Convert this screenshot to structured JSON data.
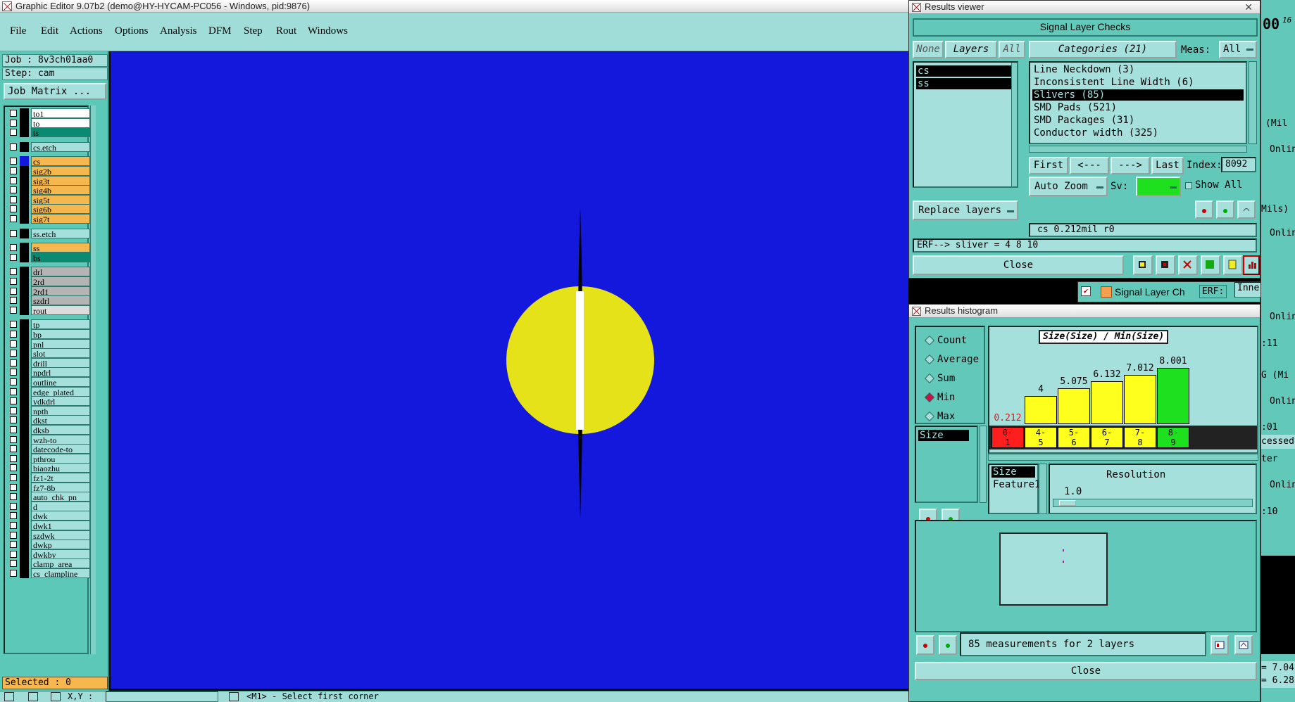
{
  "main_window": {
    "title": "Graphic Editor 9.07b2 (demo@HY-HYCAM-PC056 - Windows, pid:9876)",
    "menu": [
      "File",
      "Edit",
      "Actions",
      "Options",
      "Analysis",
      "DFM",
      "Step",
      "Rout",
      "Windows"
    ],
    "job_line": "Job : 8v3ch01aa0",
    "step_line": "Step: cam",
    "job_matrix_label": "Job Matrix ...",
    "selected_label": "Selected : 0",
    "bottom_coord_label": "X,Y :",
    "bottom_prompt": "<M1> - Select first corner",
    "layers": [
      {
        "name": "to1",
        "color": "#ffffff",
        "group": 0
      },
      {
        "name": "to",
        "color": "#ffffff",
        "group": 0
      },
      {
        "name": "ts",
        "color": "#0a8a70",
        "group": 0
      },
      {
        "name": "cs.etch",
        "color": "#a6e0dc",
        "group": 1
      },
      {
        "name": "cs",
        "color": "#f6b84e",
        "group": 2,
        "active": true
      },
      {
        "name": "sig2b",
        "color": "#f6b84e",
        "group": 2
      },
      {
        "name": "sig3t",
        "color": "#f6b84e",
        "group": 2
      },
      {
        "name": "sig4b",
        "color": "#f6b84e",
        "group": 2
      },
      {
        "name": "sig5t",
        "color": "#f6b84e",
        "group": 2
      },
      {
        "name": "sig6b",
        "color": "#f6b84e",
        "group": 2
      },
      {
        "name": "sig7t",
        "color": "#f6b84e",
        "group": 2
      },
      {
        "name": "ss.etch",
        "color": "#a6e0dc",
        "group": 3
      },
      {
        "name": "ss",
        "color": "#f6b84e",
        "group": 4
      },
      {
        "name": "bs",
        "color": "#0a8a70",
        "group": 4
      },
      {
        "name": "drl",
        "color": "#b4b4b4",
        "group": 5
      },
      {
        "name": "2rd",
        "color": "#b4b4b4",
        "group": 5
      },
      {
        "name": "2rd1",
        "color": "#b4b4b4",
        "group": 5
      },
      {
        "name": "szdrl",
        "color": "#b4b4b4",
        "group": 5
      },
      {
        "name": "rout",
        "color": "#dcdcdc",
        "group": 5
      },
      {
        "name": "tp",
        "color": "#a6e0dc",
        "group": 6
      },
      {
        "name": "bp",
        "color": "#a6e0dc",
        "group": 6
      },
      {
        "name": "pnl",
        "color": "#a6e0dc",
        "group": 6
      },
      {
        "name": "slot",
        "color": "#a6e0dc",
        "group": 6
      },
      {
        "name": "drill",
        "color": "#a6e0dc",
        "group": 6
      },
      {
        "name": "npdrl",
        "color": "#a6e0dc",
        "group": 6
      },
      {
        "name": "outline",
        "color": "#a6e0dc",
        "group": 6
      },
      {
        "name": "edge_plated",
        "color": "#a6e0dc",
        "group": 6
      },
      {
        "name": "ydkdrl",
        "color": "#a6e0dc",
        "group": 6
      },
      {
        "name": "npth",
        "color": "#a6e0dc",
        "group": 6
      },
      {
        "name": "dkst",
        "color": "#a6e0dc",
        "group": 6
      },
      {
        "name": "dksb",
        "color": "#a6e0dc",
        "group": 6
      },
      {
        "name": "wzh-to",
        "color": "#a6e0dc",
        "group": 6
      },
      {
        "name": "datecode-to",
        "color": "#a6e0dc",
        "group": 6
      },
      {
        "name": "pthrou",
        "color": "#a6e0dc",
        "group": 6
      },
      {
        "name": "biaozhu",
        "color": "#a6e0dc",
        "group": 6
      },
      {
        "name": "fz1-2t",
        "color": "#a6e0dc",
        "group": 6
      },
      {
        "name": "fz7-8b",
        "color": "#a6e0dc",
        "group": 6
      },
      {
        "name": "auto_chk_pn",
        "color": "#a6e0dc",
        "group": 6
      },
      {
        "name": "d",
        "color": "#a6e0dc",
        "group": 6
      },
      {
        "name": "dwk",
        "color": "#a6e0dc",
        "group": 6
      },
      {
        "name": "dwk1",
        "color": "#a6e0dc",
        "group": 6
      },
      {
        "name": "szdwk",
        "color": "#a6e0dc",
        "group": 6
      },
      {
        "name": "dwkp",
        "color": "#a6e0dc",
        "group": 6
      },
      {
        "name": "dwkby",
        "color": "#a6e0dc",
        "group": 6
      },
      {
        "name": "clamp_area",
        "color": "#a6e0dc",
        "group": 6
      },
      {
        "name": "cs_clampline",
        "color": "#a6e0dc",
        "group": 6
      }
    ],
    "canvas_colors": {
      "background": "#1418dc",
      "pad": "#e6e21a",
      "sliver": "#000000",
      "gap": "#ffffff"
    }
  },
  "results_viewer": {
    "title": "Results viewer",
    "header": "Signal Layer Checks",
    "none_btn": "None",
    "layers_btn": "Layers",
    "all_btn": "All",
    "layer_items": [
      "cs",
      "ss"
    ],
    "categories_label": "Categories (21)",
    "meas_label": "Meas:",
    "meas_value": "All",
    "categories": [
      "Line Neckdown (3)",
      "Inconsistent Line Width (6)",
      "Slivers (85)",
      "SMD Pads (521)",
      "SMD Packages (31)",
      "Conductor width (325)"
    ],
    "selected_category_index": 2,
    "first_btn": "First",
    "prev_btn": "<---",
    "next_btn": "--->",
    "last_btn": "Last",
    "index_label": "Index:",
    "index_value": "8092",
    "auto_zoom": "Auto Zoom",
    "sv_label": "Sv:",
    "show_all": "Show All",
    "replace_layers": "Replace layers",
    "measure_line": "cs 0.212mil  r0",
    "erf_line": "ERF--> sliver = 4 8 10",
    "close_btn": "Close",
    "del_label": "DEL",
    "ref_label": "REF",
    "undo_label": "UNDO"
  },
  "results_histogram": {
    "title": "Results histogram",
    "modes": [
      "Count",
      "Average",
      "Sum",
      "Min",
      "Max"
    ],
    "selected_mode_index": 3,
    "field_list": [
      "Size"
    ],
    "chart_title": "Size(Size) / Min(Size)",
    "axis_list": [
      "Size",
      "Feature1"
    ],
    "resolution_label": "Resolution",
    "resolution_value": "1.0",
    "status": "85 measurements for 2 layers",
    "close_btn": "Close",
    "del_label": "DEL",
    "ref_label": "REF"
  },
  "chart_data": {
    "type": "bar",
    "title": "Size(Size) / Min(Size)",
    "categories": [
      "0-1",
      "4-5",
      "5-6",
      "6-7",
      "7-8",
      "8-9"
    ],
    "values": [
      0.212,
      4,
      5.075,
      6.132,
      7.012,
      8.001
    ],
    "value_labels": [
      "0.212",
      "4",
      "5.075",
      "6.132",
      "7.012",
      "8.001"
    ],
    "bar_colors": [
      "#ffff1e",
      "#ffff1e",
      "#ffff1e",
      "#ffff1e",
      "#ffff1e",
      "#1ee01e"
    ],
    "label_colors": [
      "#e01818",
      "#000000",
      "#000000",
      "#000000",
      "#000000",
      "#000000"
    ],
    "category_colors": [
      "#ff1e1e",
      "#ffff1e",
      "#ffff1e",
      "#ffff1e",
      "#ffff1e",
      "#1ee01e"
    ],
    "ylim": [
      0,
      9
    ]
  },
  "behind_windows": {
    "signal_tab": "Signal Layer Ch",
    "erf_label": "ERF:",
    "inner_field": "Inner",
    "right_strip_items": [
      "(Mil",
      "Onlin",
      "Mils)",
      "Onlin",
      "Onlin",
      ":11",
      "G (Mi",
      "Onlin",
      ":01",
      "cessed",
      "ter",
      "Onlin",
      ":10",
      "= 7.04",
      "= 6.28"
    ],
    "top_right_digits": "00",
    "top_right_small": "16"
  }
}
